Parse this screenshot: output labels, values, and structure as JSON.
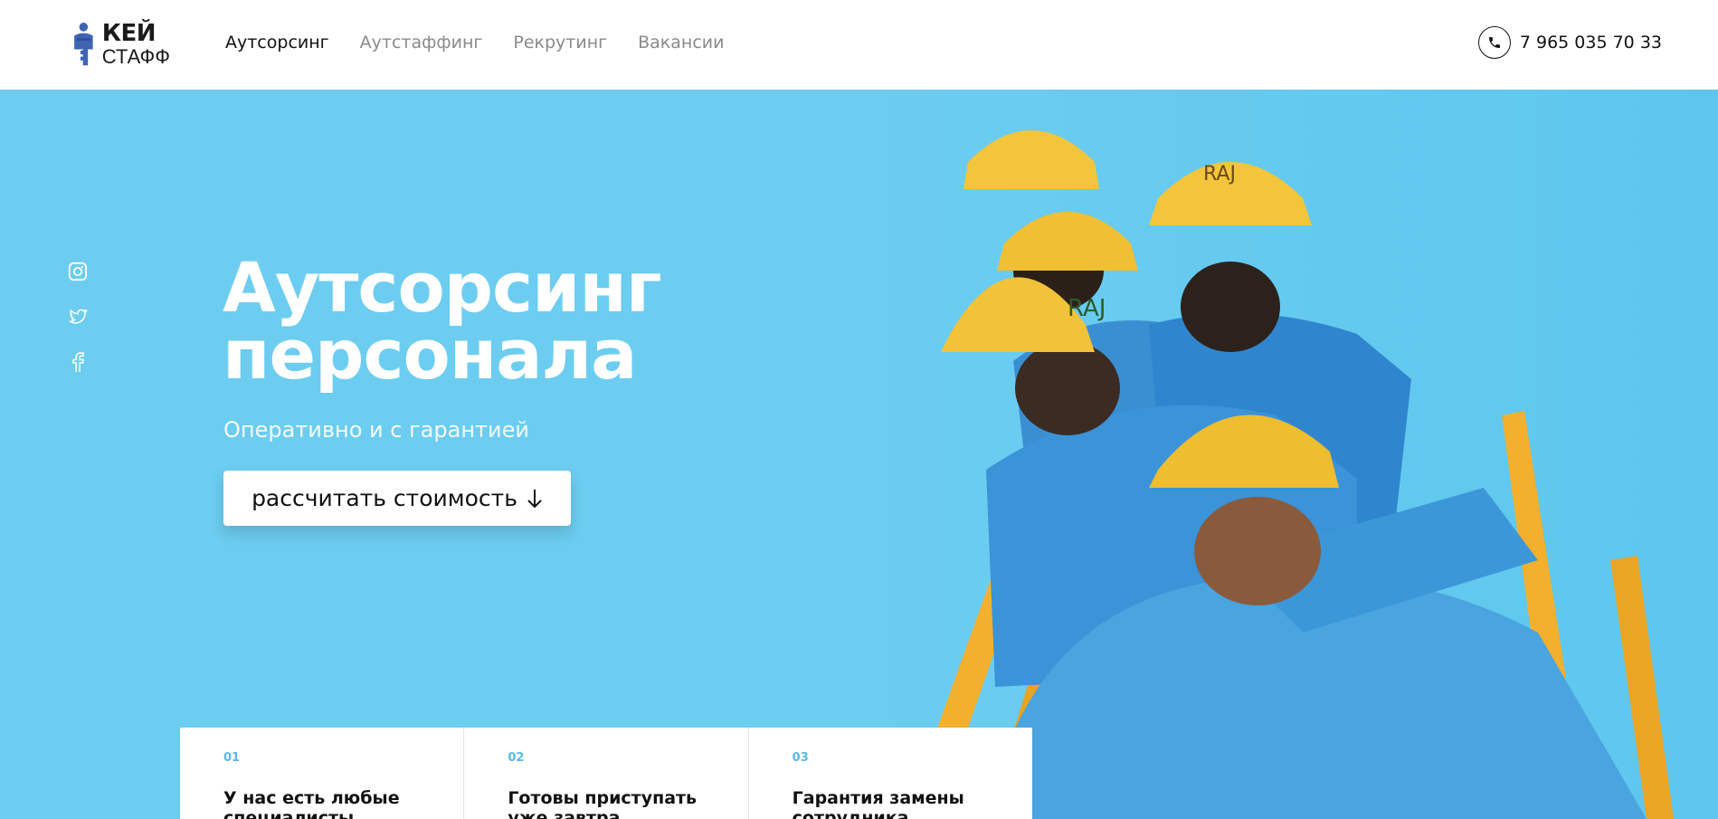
{
  "brand": {
    "name_line1": "КЕЙ",
    "name_line2": "СТАФФ",
    "mark_icon": "key-person-logo",
    "colors": {
      "primary": "#3f64b4",
      "dark": "#1b1b1b"
    }
  },
  "nav": {
    "items": [
      {
        "label": "Аутсорсинг",
        "active": true
      },
      {
        "label": "Аутстаффинг",
        "active": false
      },
      {
        "label": "Рекрутинг",
        "active": false
      },
      {
        "label": "Вакансии",
        "active": false
      }
    ]
  },
  "contact": {
    "phone_icon": "phone-icon",
    "phone": "7 965 035 70 33"
  },
  "social": {
    "icons": [
      "instagram-icon",
      "twitter-icon",
      "facebook-icon"
    ]
  },
  "hero": {
    "title": "Аутсорсинг персонала",
    "subtitle": "Оперативно и с гарантией",
    "cta_label": "рассчитать стоимость",
    "cta_icon": "arrow-down-icon",
    "background_color": "#6ccdf0",
    "image": "workers-in-helmets-photo"
  },
  "features": [
    {
      "num": "01",
      "title": "У нас есть любые специалисты"
    },
    {
      "num": "02",
      "title": "Готовы приступать уже завтра"
    },
    {
      "num": "03",
      "title": "Гарантия замены сотрудника"
    }
  ],
  "accent_color": "#5db7e3"
}
